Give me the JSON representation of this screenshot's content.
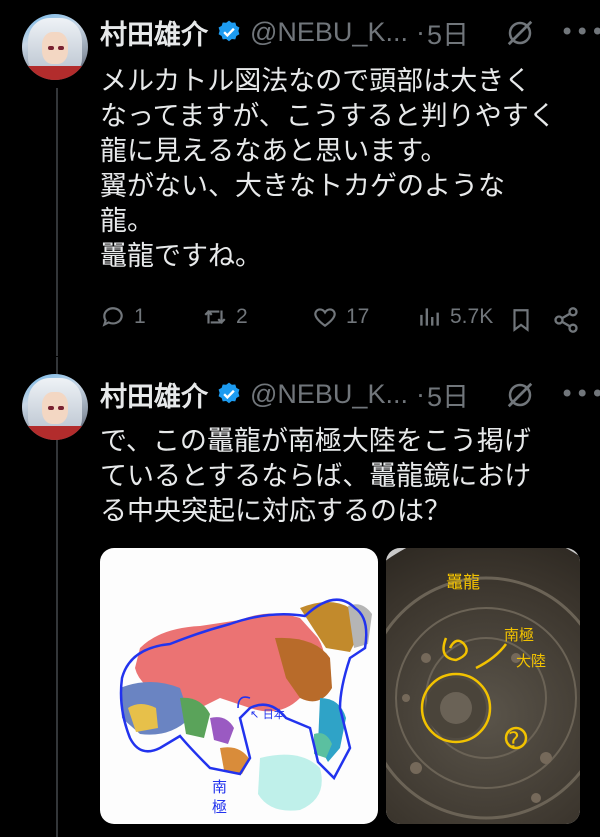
{
  "tweets": [
    {
      "name": "村田雄介",
      "handle": "@NEBU_K...",
      "time": "5日",
      "text": "メルカトル図法なので頭部は大きく\nなってますが、こうすると判りやすく\n龍に見えるなあと思います。\n翼がない、大きなトカゲのような\n龍。\n鼉龍ですね。",
      "stats": {
        "replies": "1",
        "retweets": "2",
        "likes": "17",
        "views": "5.7K"
      }
    },
    {
      "name": "村田雄介",
      "handle": "@NEBU_K...",
      "time": "5日",
      "text": "で、この鼉龍が南極大陸をこう掲げ\nているとするならば、鼉龍鏡におけ\nる中央突起に対応するのは？",
      "media": {
        "map_labels": [
          "日本",
          "南\n極"
        ],
        "mirror_labels": [
          "鼉龍",
          "南極\n大陸",
          "?"
        ]
      }
    }
  ],
  "colors": {
    "accent": "#1d9bf0",
    "muted": "#71767b",
    "text": "#e7e9ea",
    "annotation_blue": "#2233ee",
    "annotation_yellow": "#f2c200"
  },
  "icons": [
    "verified-badge-icon",
    "grok-icon",
    "more-icon",
    "reply-icon",
    "retweet-icon",
    "like-icon",
    "views-icon",
    "bookmark-icon",
    "share-icon"
  ]
}
